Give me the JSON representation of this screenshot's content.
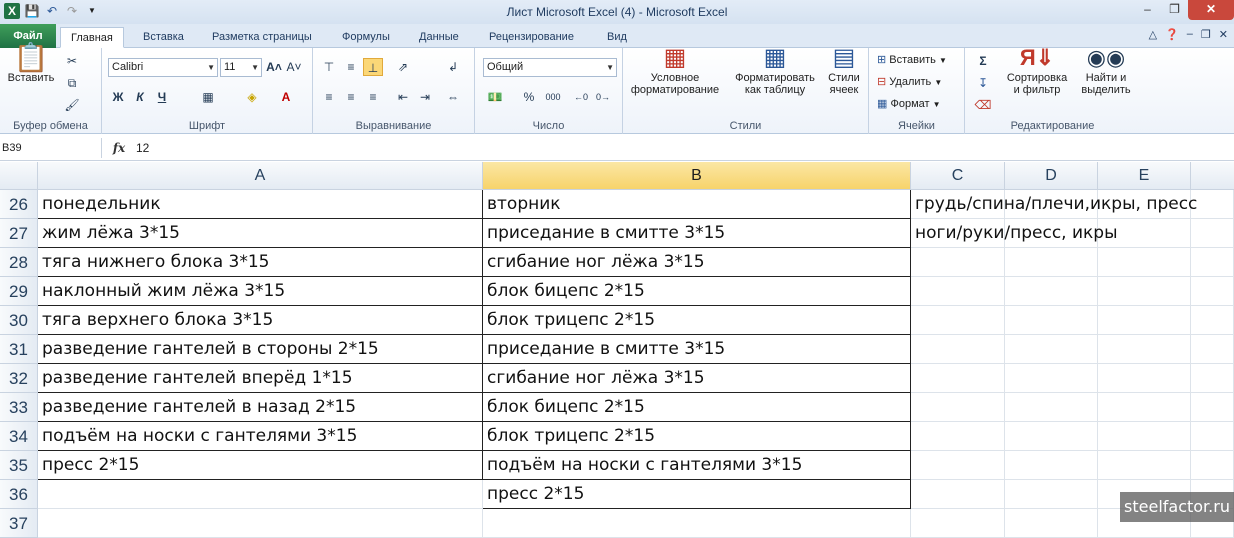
{
  "window": {
    "title": "Лист Microsoft Excel (4)  -  Microsoft Excel"
  },
  "tabs": {
    "file": "Файл",
    "items": [
      "Главная",
      "Вставка",
      "Разметка страницы",
      "Формулы",
      "Данные",
      "Рецензирование",
      "Вид"
    ]
  },
  "ribbon": {
    "clipboard": {
      "paste": "Вставить",
      "group": "Буфер обмена"
    },
    "font": {
      "name": "Calibri",
      "size": "11",
      "bold": "Ж",
      "italic": "К",
      "underline": "Ч",
      "group": "Шрифт"
    },
    "align": {
      "group": "Выравнивание"
    },
    "number": {
      "format": "Общий",
      "percent": "%",
      "thousands": "000",
      "group": "Число"
    },
    "styles": {
      "conditional": "Условное форматирование",
      "table": "Форматировать как таблицу",
      "cell": "Стили ячеек",
      "group": "Стили"
    },
    "cells": {
      "insert": "Вставить",
      "delete": "Удалить",
      "format": "Формат",
      "group": "Ячейки"
    },
    "edit": {
      "sort": "Сортировка и фильтр",
      "find": "Найти и выделить",
      "group": "Редактирование"
    }
  },
  "formula_bar": {
    "name_box": "B39",
    "fx": "fx",
    "value": "12"
  },
  "columns": [
    "A",
    "B",
    "C",
    "D",
    "E"
  ],
  "rows": [
    {
      "num": "26",
      "a": "понедельник",
      "b": "вторник",
      "c": "грудь/спина/плечи,икры, пресс"
    },
    {
      "num": "27",
      "a": "жим лёжа 3*15",
      "b": "приседание в смитте 3*15",
      "c": " ноги/руки/пресс, икры"
    },
    {
      "num": "28",
      "a": "тяга нижнего блока 3*15",
      "b": "сгибание ног лёжа 3*15",
      "c": ""
    },
    {
      "num": "29",
      "a": "наклонный жим лёжа  3*15",
      "b": "блок бицепс   2*15",
      "c": ""
    },
    {
      "num": "30",
      "a": "тяга верхнего блока 3*15",
      "b": "блок трицепс   2*15",
      "c": ""
    },
    {
      "num": "31",
      "a": "разведение гантелей в стороны 2*15",
      "b": "приседание в смитте 3*15",
      "c": ""
    },
    {
      "num": "32",
      "a": "разведение гантелей вперёд 1*15",
      "b": "сгибание ног лёжа 3*15",
      "c": ""
    },
    {
      "num": "33",
      "a": "разведение гантелей в назад 2*15",
      "b": "блок бицепс   2*15",
      "c": ""
    },
    {
      "num": "34",
      "a": "подъём на носки с гантелями 3*15",
      "b": "блок трицепс   2*15",
      "c": ""
    },
    {
      "num": "35",
      "a": "пресс 2*15",
      "b": "подъём на носки с гантелями 3*15",
      "c": ""
    },
    {
      "num": "36",
      "a": "",
      "b": "пресс 2*15",
      "c": ""
    },
    {
      "num": "37",
      "a": "",
      "b": "",
      "c": ""
    }
  ],
  "watermark": "steelfactor.ru"
}
